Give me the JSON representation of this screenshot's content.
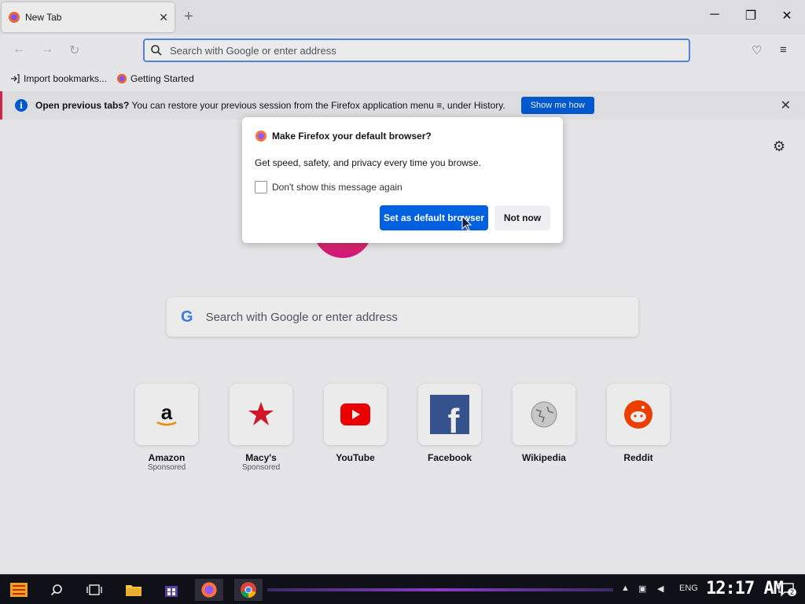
{
  "browser": {
    "tab": {
      "title": "New Tab",
      "close": "✕"
    },
    "new_tab": "+",
    "window_controls": {
      "minimize": "─",
      "restore": "❐",
      "close": "✕"
    },
    "nav": {
      "back": "←",
      "forward": "→",
      "reload": "↻"
    },
    "urlbar": {
      "placeholder": "Search with Google or enter address"
    },
    "toolbar_right": {
      "pocket": "♡",
      "menu": "≡"
    },
    "bookmarks": [
      {
        "label": "Import bookmarks...",
        "icon": "import-icon"
      },
      {
        "label": "Getting Started",
        "icon": "firefox-icon"
      }
    ]
  },
  "notification": {
    "bold": "Open previous tabs?",
    "text": " You can restore your previous session from the Firefox application menu ≡, under History.",
    "button": "Show me how",
    "close": "✕"
  },
  "newtab": {
    "search_placeholder": "Search with Google or enter address",
    "tiles": [
      {
        "name": "Amazon",
        "sponsored": "Sponsored",
        "icon": "amazon-icon"
      },
      {
        "name": "Macy's",
        "sponsored": "Sponsored",
        "icon": "macys-icon"
      },
      {
        "name": "YouTube",
        "sponsored": "",
        "icon": "youtube-icon"
      },
      {
        "name": "Facebook",
        "sponsored": "",
        "icon": "facebook-icon"
      },
      {
        "name": "Wikipedia",
        "sponsored": "",
        "icon": "wikipedia-icon"
      },
      {
        "name": "Reddit",
        "sponsored": "",
        "icon": "reddit-icon"
      }
    ]
  },
  "dialog": {
    "title": "Make Firefox your default browser?",
    "body": "Get speed, safety, and privacy every time you browse.",
    "checkbox_label": "Don't show this message again",
    "checkbox_checked": false,
    "primary_button": "Set as default browser",
    "secondary_button": "Not now"
  },
  "taskbar": {
    "language": "ENG",
    "clock": "12:17 AM",
    "notifications_count": "2"
  },
  "colors": {
    "accent": "#0060df",
    "notification_border": "#e22850",
    "taskbar_bg": "#101018"
  }
}
